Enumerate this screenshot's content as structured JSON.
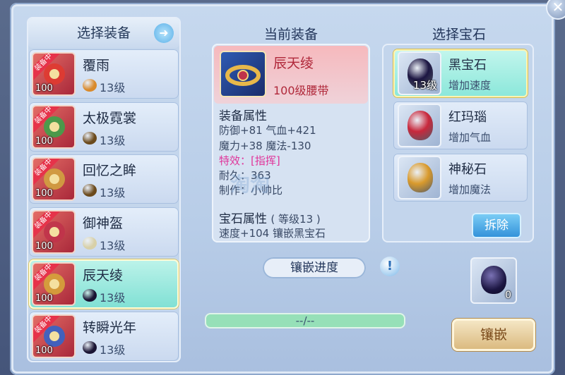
{
  "left_panel": {
    "title": "选择装备",
    "items": [
      {
        "name": "覆雨",
        "level": "100",
        "tag": "装备中",
        "gem_level": "13级",
        "gem_color": "#d98a2c",
        "icon_color": "#e03a30"
      },
      {
        "name": "太极霓裳",
        "level": "100",
        "tag": "装备中",
        "gem_level": "13级",
        "gem_color": "#6b4a1c",
        "icon_color": "#3fa24a"
      },
      {
        "name": "回忆之眸",
        "level": "100",
        "tag": "装备中",
        "gem_level": "13级",
        "gem_color": "#6b4a1c",
        "icon_color": "#d2a240"
      },
      {
        "name": "御神盔",
        "level": "100",
        "tag": "装备中",
        "gem_level": "13级",
        "gem_color": "#d8d0a8",
        "icon_color": "#c0334a"
      },
      {
        "name": "辰天绫",
        "level": "100",
        "tag": "装备中",
        "gem_level": "13级",
        "gem_color": "#1a1433",
        "icon_color": "#d6a43a"
      },
      {
        "name": "转瞬光年",
        "level": "100",
        "tag": "装备中",
        "gem_level": "13级",
        "gem_color": "#1a1433",
        "icon_color": "#3464c8"
      }
    ],
    "selected_index": 4
  },
  "center": {
    "title": "当前装备",
    "item_name": "辰天绫",
    "item_sub": "100级腰带",
    "attr_header": "装备属性",
    "attr_line1": "防御+81 气血+421",
    "attr_line2": "魔力+38 魔法-130",
    "special": "特效：[指挥]",
    "durability": "耐久：363",
    "maker": "制作：小帅比",
    "gem_header": "宝石属性",
    "gem_level_note": "( 等级13 )",
    "gem_line": "速度+104 镶嵌黑宝石"
  },
  "progress": {
    "label": "镶嵌进度",
    "text": "--/--",
    "fraction": 0
  },
  "right_panel": {
    "title": "选择宝石",
    "gems": [
      {
        "name": "黑宝石",
        "desc": "增加速度",
        "count": "13级",
        "color": "#1c1642"
      },
      {
        "name": "红玛瑙",
        "desc": "增加气血",
        "count": "",
        "color": "#c8283c"
      },
      {
        "name": "神秘石",
        "desc": "增加魔法",
        "count": "",
        "color": "#d99a2c"
      }
    ],
    "selected_index": 0,
    "remove_label": "拆除"
  },
  "slot": {
    "count": "0"
  },
  "inlay_button": "镶嵌",
  "watermark": "淘淘"
}
